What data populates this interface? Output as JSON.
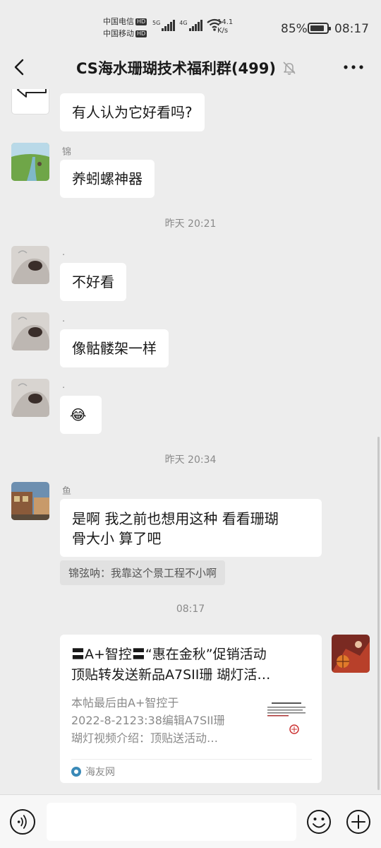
{
  "status_bar": {
    "carrier1": "中国电信",
    "carrier2": "中国移动",
    "hd": "HD",
    "sig1_label": "5G",
    "sig2_label": "4G",
    "speed_value": "14.1",
    "speed_unit": "K/s",
    "battery": "85%",
    "battery_level": 0.85,
    "time": "08:17"
  },
  "header": {
    "title": "CS海水珊瑚技术福利群(499)",
    "back_icon": "back-arrow-icon",
    "mute_icon": "bell-muted-icon",
    "more_icon": "more-dots-icon"
  },
  "messages": {
    "m1_text": "有人认为它好看吗?",
    "m2_name": "锦",
    "m2_text": "养蚓螺神器",
    "time1": "昨天 20:21",
    "m3_name": ".",
    "m3_text": "不好看",
    "m4_name": ".",
    "m4_text": "像骷髅架一样",
    "m5_name": ".",
    "m5_text": "😂",
    "time2": "昨天 20:34",
    "m6_name": "鱼",
    "m6_line1": "是啊 我之前也想用这种 看看珊瑚",
    "m6_line2": "骨大小 算了吧",
    "quote": "锦弦呐：我靠这个景工程不小啊",
    "time3": "08:17"
  },
  "card": {
    "title_line1": "〓A+智控〓“惠在金秋”促销活动",
    "title_line2": "顶贴转发送新品A7SII珊 瑚灯活…",
    "desc_line1": "本帖最后由A+智控于",
    "desc_line2": "2022-8-2123:38编辑A7SII珊",
    "desc_line3": "瑚灯视频介绍：顶贴送活动…",
    "source": "海友网"
  },
  "colors": {
    "background": "#ededed",
    "bubble": "#ffffff",
    "meta_text": "#8a8a8a",
    "quote_bg": "#e1e1e1"
  }
}
